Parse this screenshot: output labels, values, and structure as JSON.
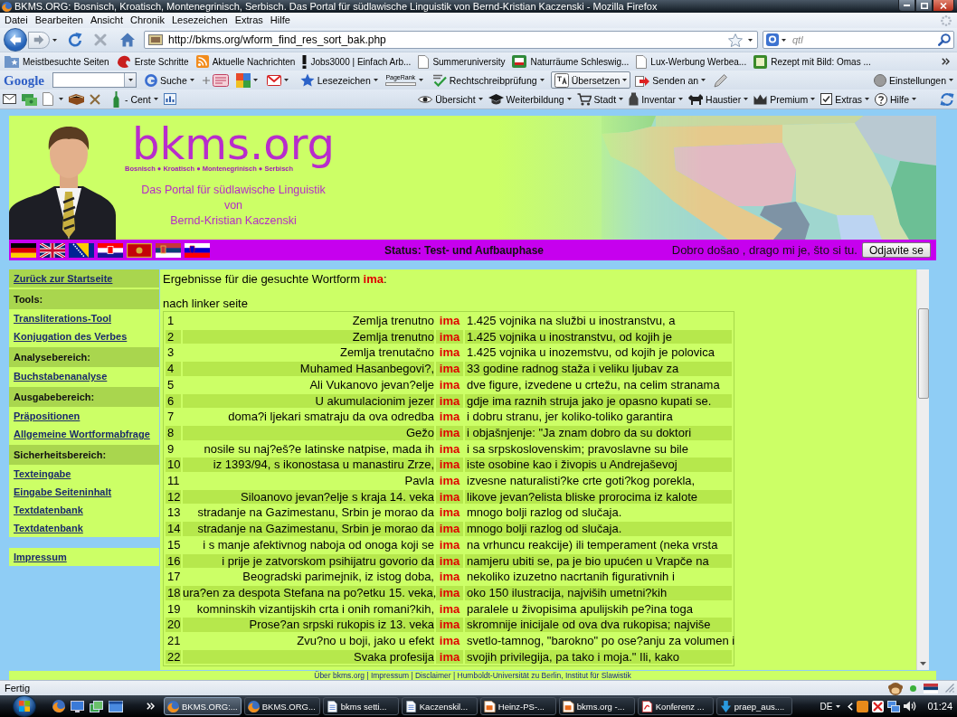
{
  "window": {
    "title": "BKMS.ORG: Bosnisch, Kroatisch, Montenegrinisch, Serbisch. Das Portal für südlawische Linguistik von Bernd-Kristian Kaczenski - Mozilla Firefox"
  },
  "menu": [
    "Datei",
    "Bearbeiten",
    "Ansicht",
    "Chronik",
    "Lesezeichen",
    "Extras",
    "Hilfe"
  ],
  "navigation": {
    "url": "http://bkms.org/wform_find_res_sort_bak.php",
    "search": {
      "placeholder": "qtl"
    }
  },
  "bookmarks": [
    "Meistbesuchte Seiten",
    "Erste Schritte",
    "Aktuelle Nachrichten",
    "Jobs3000 | Einfach Arb...",
    "Summeruniversity",
    "Naturräume Schleswig...",
    "Lux-Werbung Werbea...",
    "Rezept mit Bild: Omas ..."
  ],
  "google_toolbar": {
    "logo": "Google",
    "search_button": "Suche",
    "items": [
      {
        "kind": "menu",
        "label": "Lesezeichen",
        "on": false
      },
      {
        "kind": "meter",
        "label": "PageRank",
        "on": false
      },
      {
        "kind": "menu",
        "label": "Rechtschreibprüfung",
        "on": false
      },
      {
        "kind": "menu",
        "label": "Übersetzen",
        "on": true
      },
      {
        "kind": "menu",
        "label": "Senden an",
        "on": false
      }
    ],
    "settings": "Einstellungen"
  },
  "addon_toolbar": {
    "balance": "- Cent",
    "menus": [
      "Übersicht",
      "Weiterbildung",
      "Stadt",
      "Inventar",
      "Haustier",
      "Premium",
      "Extras",
      "Hilfe"
    ]
  },
  "site": {
    "logo": "bkms.org",
    "languages": "Bosnisch ● Kroatisch ● Montenegrinisch ● Serbisch",
    "tagline": [
      "Das Portal für südlawische Linguistik",
      "von",
      "Bernd-Kristian Kaczenski"
    ],
    "status": "Status: Test- und Aufbauphase",
    "greeting": "Dobro došao , drago mi je, što si tu.",
    "logout": "Odjavite se"
  },
  "sidebar": {
    "groups": [
      {
        "items": [
          {
            "kind": "home",
            "label": "Zurück zur Startseite"
          },
          {
            "kind": "heading",
            "label": "Tools:"
          },
          {
            "kind": "link",
            "label": "Transliterations-Tool"
          },
          {
            "kind": "link",
            "label": "Konjugation des Verbes"
          },
          {
            "kind": "heading",
            "label": "Analysebereich:"
          },
          {
            "kind": "link",
            "label": "Buchstabenanalyse"
          },
          {
            "kind": "heading",
            "label": "Ausgabebereich:"
          },
          {
            "kind": "link",
            "label": "Präpositionen"
          },
          {
            "kind": "link",
            "label": "Allgemeine Wortformabfrage"
          },
          {
            "kind": "heading",
            "label": "Sicherheitsbereich:"
          },
          {
            "kind": "link",
            "label": "Texteingabe"
          },
          {
            "kind": "link",
            "label": "Eingabe Seiteninhalt"
          },
          {
            "kind": "link",
            "label": "Textdatenbank"
          },
          {
            "kind": "link",
            "label": "Textdatenbank"
          }
        ]
      },
      {
        "items": [
          {
            "kind": "link",
            "label": "Impressum"
          }
        ]
      }
    ]
  },
  "results": {
    "heading": "Ergebnisse für die gesuchte Wortform",
    "term": "ima",
    "heading_end": ":",
    "subheading": "nach linker seite",
    "rows": [
      {
        "number": "1",
        "left": "Zemlja trenutno",
        "keyword": "ima",
        "right": "1.425 vojnika na službi u inostranstvu, a"
      },
      {
        "number": "2",
        "left": "Zemlja trenutno",
        "keyword": "ima",
        "right": "1.425 vojnika u inostranstvu, od kojih je"
      },
      {
        "number": "3",
        "left": "Zemlja trenutačno",
        "keyword": "ima",
        "right": "1.425 vojnika u inozemstvu, od kojih je polovica"
      },
      {
        "number": "4",
        "left": "Muhamed Hasanbegovi?,",
        "keyword": "ima",
        "right": "33 godine radnog staža i veliku ljubav za"
      },
      {
        "number": "5",
        "left": "Ali Vukanovo jevan?elje",
        "keyword": "ima",
        "right": "dve figure, izvedene u crtežu, na celim stranama"
      },
      {
        "number": "6",
        "left": "U akumulacionim jezer",
        "keyword": "ima",
        "right": "gdje ima raznih struja jako je opasno kupati se."
      },
      {
        "number": "7",
        "left": "doma?i ljekari smatraju da ova odredba",
        "keyword": "ima",
        "right": "i dobru stranu, jer koliko-toliko garantira"
      },
      {
        "number": "8",
        "left": "Gežo",
        "keyword": "ima",
        "right": "i objašnjenje: \"Ja znam dobro da su doktori"
      },
      {
        "number": "9",
        "left": "nosile su naj?eš?e latinske natpise, mada ih",
        "keyword": "ima",
        "right": "i sa srpskoslovenskim; pravoslavne su bile"
      },
      {
        "number": "10",
        "left": "iz 1393/94, s ikonostasa u manastiru Zrze,",
        "keyword": "ima",
        "right": "iste osobine kao i živopis u Andrejaševoj"
      },
      {
        "number": "11",
        "left": "Pavla",
        "keyword": "ima",
        "right": "izvesne naturalisti?ke crte goti?kog porekla,"
      },
      {
        "number": "12",
        "left": "Siloanovo jevan?elje s kraja 14. veka",
        "keyword": "ima",
        "right": "likove jevan?elista bliske prorocima iz kalote"
      },
      {
        "number": "13",
        "left": "stradanje na Gazimestanu, Srbin je morao da",
        "keyword": "ima",
        "right": "mnogo bolji razlog od slučaja."
      },
      {
        "number": "14",
        "left": "stradanje na Gazimestanu, Srbin je morao da",
        "keyword": "ima",
        "right": "mnogo bolji razlog od slučaja."
      },
      {
        "number": "15",
        "left": "i s manje afektivnog naboja od onoga koji se",
        "keyword": "ima",
        "right": "na vrhuncu reakcije) ili temperament (neka vrsta"
      },
      {
        "number": "16",
        "left": "i prije je zatvorskom psihijatru govorio da",
        "keyword": "ima",
        "right": "namjeru ubiti se, pa je bio upućen u Vrapče na"
      },
      {
        "number": "17",
        "left": "Beogradski parimejnik, iz istog doba,",
        "keyword": "ima",
        "right": "nekoliko izuzetno nacrtanih figurativnih i"
      },
      {
        "number": "18",
        "left": "ura?en za despota Stefana na po?etku 15. veka,",
        "keyword": "ima",
        "right": "oko 150 ilustracija, najviših umetni?kih"
      },
      {
        "number": "19",
        "left": "komninskih vizantijskih crta i onih romani?kih,",
        "keyword": "ima",
        "right": "paralele u živopisima apulijskih pe?ina toga"
      },
      {
        "number": "20",
        "left": "Prose?an srpski rukopis iz 13. veka",
        "keyword": "ima",
        "right": "skromnije inicijale od ova dva rukopisa; najviše"
      },
      {
        "number": "21",
        "left": "Zvu?no u boji, jako u efekt",
        "keyword": "ima",
        "right": "svetlo-tamnog, \"barokno\" po ose?anju za volumen i"
      },
      {
        "number": "22",
        "left": "Svaka profesija",
        "keyword": "ima",
        "right": "svojih privilegija, pa tako i moja.\" Ili, kako"
      }
    ]
  },
  "footer": "Über bkms.org | Impressum | Disclaimer | Humboldt-Universität zu Berlin, Institut für Slawistik",
  "status_bar": {
    "text": "Fertig"
  },
  "taskbar": {
    "tasks": [
      {
        "label": "BKMS.ORG:...",
        "selected": true
      },
      {
        "label": "BKMS.ORG...",
        "selected": false
      },
      {
        "label": "bkms setti...",
        "selected": false
      },
      {
        "label": "Kaczenskil...",
        "selected": false
      },
      {
        "label": "Heinz-PS-...",
        "selected": false
      },
      {
        "label": "bkms.org -...",
        "selected": false
      },
      {
        "label": "Konferenz ...",
        "selected": false
      },
      {
        "label": "praep_aus....",
        "selected": false
      }
    ],
    "language": "DE",
    "clock": "01:24"
  }
}
